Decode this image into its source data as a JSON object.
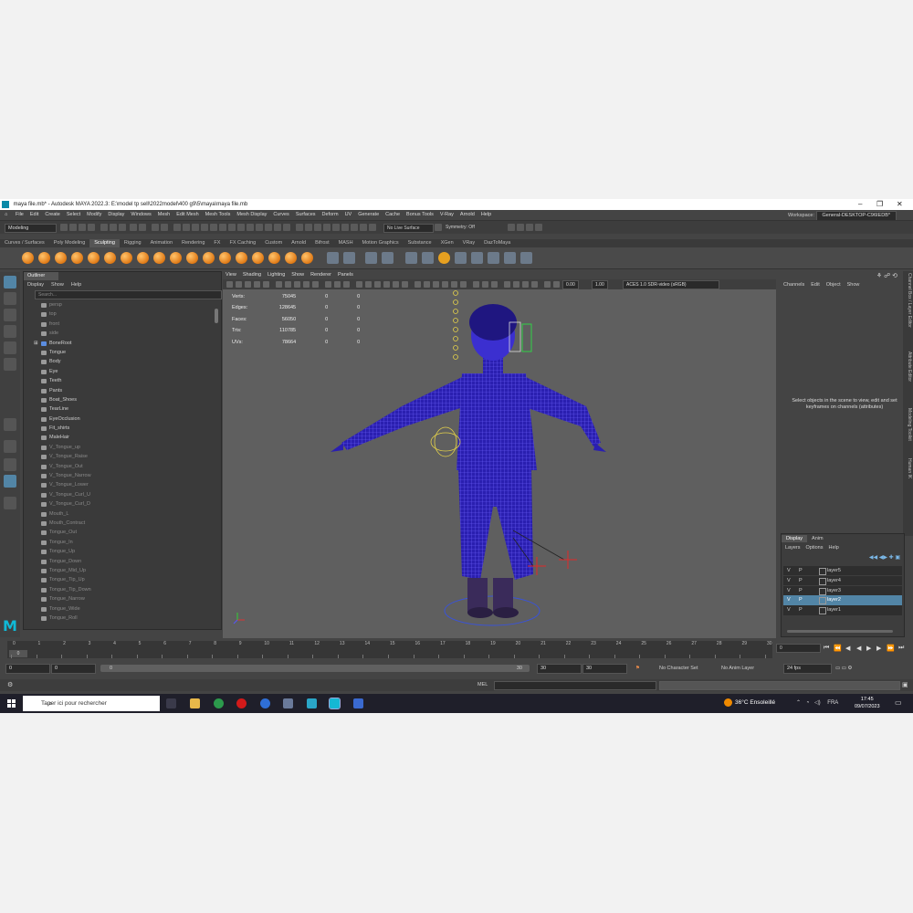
{
  "window": {
    "title": "maya file.mb* - Autodesk MAYA 2022.3: E:\\model tp sell\\2022model\\400 g9\\5\\maya\\maya file.mb",
    "min": "–",
    "max": "❐",
    "close": "✕"
  },
  "menu": [
    "File",
    "Edit",
    "Create",
    "Select",
    "Modify",
    "Display",
    "Windows",
    "Mesh",
    "Edit Mesh",
    "Mesh Tools",
    "Mesh Display",
    "Curves",
    "Surfaces",
    "Deform",
    "UV",
    "Generate",
    "Cache",
    "Bonus Tools",
    "V-Ray",
    "Arnold",
    "Help"
  ],
  "workspace": {
    "label": "Workspace:",
    "value": "General-DESKTOP-C96IEDB*"
  },
  "status": {
    "mode": "Modeling",
    "live_surface": "No Live Surface",
    "symmetry": "Symmetry: Off"
  },
  "shelf_tabs": [
    "Curves / Surfaces",
    "Poly Modeling",
    "Sculpting",
    "Rigging",
    "Animation",
    "Rendering",
    "FX",
    "FX Caching",
    "Custom",
    "Arnold",
    "Bifrost",
    "MASH",
    "Motion Graphics",
    "Substance",
    "XGen",
    "VRay",
    "DazToMaya"
  ],
  "shelf_active": "Sculpting",
  "outliner": {
    "title": "Outliner",
    "menu": [
      "Display",
      "Show",
      "Help"
    ],
    "search_placeholder": "Search...",
    "items": [
      {
        "name": "persp",
        "kind": "cam",
        "dim": true
      },
      {
        "name": "top",
        "kind": "cam",
        "dim": true
      },
      {
        "name": "front",
        "kind": "cam",
        "dim": true
      },
      {
        "name": "side",
        "kind": "cam",
        "dim": true
      },
      {
        "name": "BoneRoot",
        "kind": "bone",
        "dim": false
      },
      {
        "name": "Tongue",
        "kind": "mesh",
        "dim": false
      },
      {
        "name": "Body",
        "kind": "mesh",
        "dim": false
      },
      {
        "name": "Eye",
        "kind": "mesh",
        "dim": false
      },
      {
        "name": "Teeth",
        "kind": "mesh",
        "dim": false
      },
      {
        "name": "Pants",
        "kind": "mesh",
        "dim": false
      },
      {
        "name": "Boat_Shoes",
        "kind": "mesh",
        "dim": false
      },
      {
        "name": "TearLine",
        "kind": "mesh",
        "dim": false
      },
      {
        "name": "EyeOcclusion",
        "kind": "mesh",
        "dim": false
      },
      {
        "name": "Fit_shirts",
        "kind": "mesh",
        "dim": false
      },
      {
        "name": "MaleHair",
        "kind": "mesh",
        "dim": false
      },
      {
        "name": "V_Tongue_up",
        "kind": "mesh",
        "dim": true
      },
      {
        "name": "V_Tongue_Raise",
        "kind": "mesh",
        "dim": true
      },
      {
        "name": "V_Tongue_Out",
        "kind": "mesh",
        "dim": true
      },
      {
        "name": "V_Tongue_Narrow",
        "kind": "mesh",
        "dim": true
      },
      {
        "name": "V_Tongue_Lower",
        "kind": "mesh",
        "dim": true
      },
      {
        "name": "V_Tongue_Curl_U",
        "kind": "mesh",
        "dim": true
      },
      {
        "name": "V_Tongue_Curl_D",
        "kind": "mesh",
        "dim": true
      },
      {
        "name": "Mouth_L",
        "kind": "mesh",
        "dim": true
      },
      {
        "name": "Mouth_Contract",
        "kind": "mesh",
        "dim": true
      },
      {
        "name": "Tongue_Out",
        "kind": "mesh",
        "dim": true
      },
      {
        "name": "Tongue_In",
        "kind": "mesh",
        "dim": true
      },
      {
        "name": "Tongue_Up",
        "kind": "mesh",
        "dim": true
      },
      {
        "name": "Tongue_Down",
        "kind": "mesh",
        "dim": true
      },
      {
        "name": "Tongue_Mid_Up",
        "kind": "mesh",
        "dim": true
      },
      {
        "name": "Tongue_Tip_Up",
        "kind": "mesh",
        "dim": true
      },
      {
        "name": "Tongue_Tip_Down",
        "kind": "mesh",
        "dim": true
      },
      {
        "name": "Tongue_Narrow",
        "kind": "mesh",
        "dim": true
      },
      {
        "name": "Tongue_Wide",
        "kind": "mesh",
        "dim": true
      },
      {
        "name": "Tongue_Roll",
        "kind": "mesh",
        "dim": true
      }
    ]
  },
  "viewport": {
    "menu": [
      "View",
      "Shading",
      "Lighting",
      "Show",
      "Renderer",
      "Panels"
    ],
    "exposure": "0.00",
    "gamma": "1.00",
    "color_space": "ACES 1.0 SDR-video (sRGB)",
    "stats": [
      {
        "label": "Verts:",
        "value": "75045",
        "a": "0",
        "b": "0"
      },
      {
        "label": "Edges:",
        "value": "128645",
        "a": "0",
        "b": "0"
      },
      {
        "label": "Faces:",
        "value": "56050",
        "a": "0",
        "b": "0"
      },
      {
        "label": "Tris:",
        "value": "110785",
        "a": "0",
        "b": "0"
      },
      {
        "label": "UVs:",
        "value": "78664",
        "a": "0",
        "b": "0"
      }
    ]
  },
  "channels": {
    "menu": [
      "Channels",
      "Edit",
      "Object",
      "Show"
    ],
    "message": "Select objects in the scene to view, edit and set keyframes on channels (attributes)"
  },
  "side_tabs": [
    "Channel Box / Layer Editor",
    "Attribute Editor",
    "Modeling Toolkit",
    "Human IK"
  ],
  "layers": {
    "tabs": [
      "Display",
      "Anim"
    ],
    "menu": [
      "Layers",
      "Options",
      "Help"
    ],
    "rows": [
      {
        "v": "V",
        "p": "P",
        "name": "layer5",
        "selected": false
      },
      {
        "v": "V",
        "p": "P",
        "name": "layer4",
        "selected": false
      },
      {
        "v": "V",
        "p": "P",
        "name": "layer3",
        "selected": false
      },
      {
        "v": "V",
        "p": "P",
        "name": "layer2",
        "selected": true
      },
      {
        "v": "V",
        "p": "P",
        "name": "layer1",
        "selected": false
      }
    ]
  },
  "timeline": {
    "ticks": [
      "0",
      "1",
      "2",
      "3",
      "4",
      "5",
      "6",
      "7",
      "8",
      "9",
      "10",
      "11",
      "12",
      "13",
      "14",
      "15",
      "16",
      "17",
      "18",
      "19",
      "20",
      "21",
      "22",
      "23",
      "24",
      "25",
      "26",
      "27",
      "28",
      "29",
      "30"
    ],
    "current": "0"
  },
  "range": {
    "start_a": "0",
    "start_b": "0",
    "slider_start": "0",
    "slider_end": "30",
    "end_a": "30",
    "end_b": "30",
    "character": "No Character Set",
    "anim_layer": "No Anim Layer",
    "fps": "24 fps"
  },
  "command": {
    "lang": "MEL"
  },
  "taskbar": {
    "search_placeholder": "Taper ici pour rechercher",
    "weather": "36°C Ensoleillé",
    "lang": "FRA",
    "time": "17:45",
    "date": "09/07/2023"
  },
  "colors": {
    "accent": "#5285a6",
    "maya_logo": "#10b9d6",
    "wire": "#3b2fd0"
  }
}
